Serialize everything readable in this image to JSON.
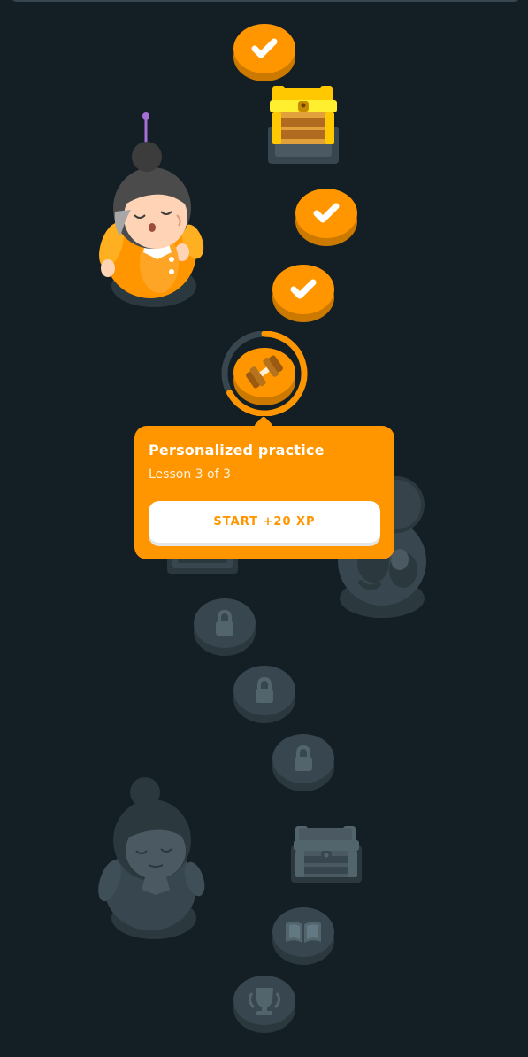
{
  "colors": {
    "background": "#131f24",
    "accent": "#ff9600",
    "accent_dark": "#cc7900",
    "locked": "#37464f",
    "locked_dark": "#2b383e"
  },
  "path": {
    "completed_lessons": [
      {
        "state": "completed",
        "icon": "check-icon"
      },
      {
        "state": "completed",
        "icon": "check-icon"
      },
      {
        "state": "completed",
        "icon": "check-icon"
      }
    ],
    "reward_chest_open": {
      "state": "opened",
      "icon": "chest-icon"
    },
    "current_node": {
      "state": "active",
      "icon": "dumbbell-icon",
      "progress": 0.67
    },
    "locked_lessons": [
      {
        "state": "locked",
        "icon": "lock-icon"
      },
      {
        "state": "locked",
        "icon": "lock-icon"
      },
      {
        "state": "locked",
        "icon": "lock-icon"
      }
    ],
    "reward_chest_locked": {
      "state": "locked",
      "icon": "chest-icon"
    },
    "story_node": {
      "state": "locked",
      "icon": "book-icon"
    },
    "trophy_node": {
      "state": "locked",
      "icon": "trophy-icon"
    }
  },
  "popover": {
    "title": "Personalized practice",
    "subtitle": "Lesson 3 of 3",
    "button_label": "START +20 XP"
  }
}
